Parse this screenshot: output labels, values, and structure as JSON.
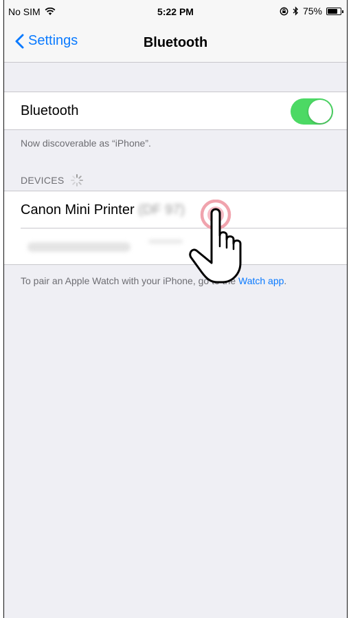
{
  "status_bar": {
    "carrier": "No SIM",
    "time": "5:22 PM",
    "battery_percent": "75%",
    "battery_level": 0.75
  },
  "nav": {
    "back_label": "Settings",
    "title": "Bluetooth"
  },
  "bluetooth_row": {
    "label": "Bluetooth",
    "toggle_on": true,
    "toggle_color": "#4cd964"
  },
  "discoverable_text": "Now discoverable as “iPhone”.",
  "devices_header": "DEVICES",
  "devices": [
    {
      "name": "Canon Mini Printer",
      "id_blurred": "(DF 97)"
    },
    {
      "name": "",
      "id_blurred": ""
    }
  ],
  "footer": {
    "text_before": "To pair an Apple Watch with your iPhone, go to the ",
    "link": "Watch app",
    "text_after": "."
  },
  "accent_color": "#0a7aff"
}
